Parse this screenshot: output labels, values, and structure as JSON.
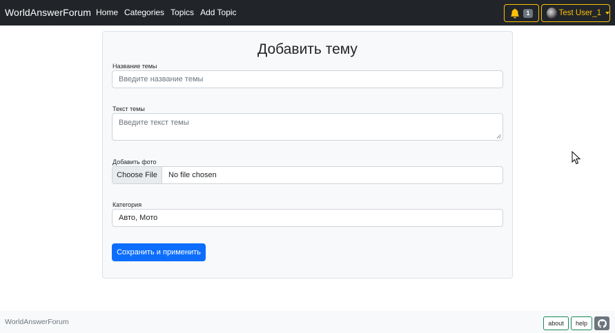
{
  "navbar": {
    "brand": "WorldAnswerForum",
    "links": [
      "Home",
      "Categories",
      "Topics",
      "Add Topic"
    ],
    "notifications": {
      "icon": "bell-icon",
      "count": "1"
    },
    "user": {
      "name": "Test User_1",
      "icon": "avatar"
    }
  },
  "form": {
    "title": "Добавить тему",
    "topic_name": {
      "label": "Название темы",
      "placeholder": "Введите название темы"
    },
    "topic_text": {
      "label": "Текст темы",
      "placeholder": "Введите текст темы"
    },
    "photo": {
      "label": "Добавить фото",
      "button": "Choose File",
      "status": "No file chosen"
    },
    "category": {
      "label": "Категория",
      "value": "Авто, Мото"
    },
    "submit_label": "Сохранить и применить"
  },
  "footer": {
    "brand": "WorldAnswerForum",
    "about": "about",
    "help": "help",
    "github_icon": "github-icon"
  },
  "colors": {
    "navbar_bg": "#212529",
    "accent_warning": "#ffc107",
    "primary": "#0d6efd",
    "success_outline": "#198754"
  }
}
